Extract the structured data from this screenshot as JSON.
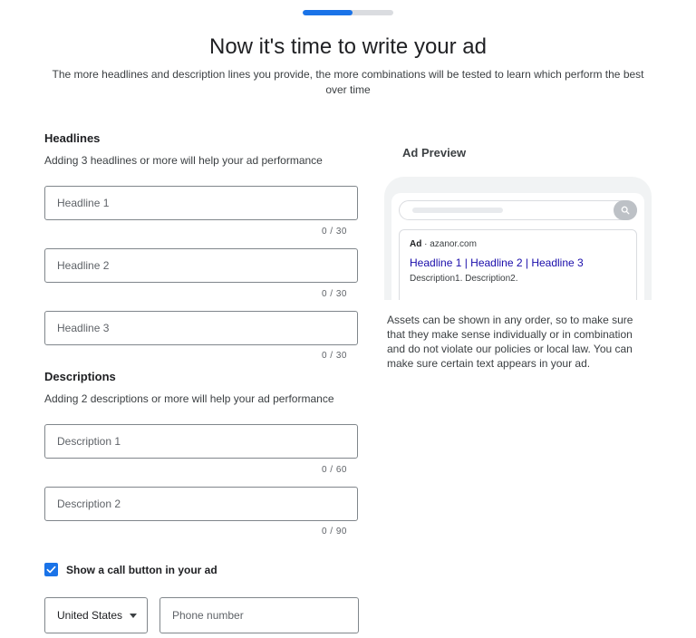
{
  "progress": {
    "value": 0.55,
    "color": "#1a73e8"
  },
  "title": "Now it's time to write your ad",
  "subtitle": "The more headlines and description lines you provide, the more combinations will be tested to learn which perform the best over time",
  "headlines": {
    "title": "Headlines",
    "hint": "Adding 3 headlines or more will help your ad performance",
    "fields": [
      {
        "placeholder": "Headline 1",
        "value": "",
        "counter": "0 / 30"
      },
      {
        "placeholder": "Headline 2",
        "value": "",
        "counter": "0 / 30"
      },
      {
        "placeholder": "Headline 3",
        "value": "",
        "counter": "0 / 30"
      }
    ]
  },
  "descriptions": {
    "title": "Descriptions",
    "hint": "Adding 2 descriptions or more will help your ad performance",
    "fields": [
      {
        "placeholder": "Description 1",
        "value": "",
        "counter": "0 / 60"
      },
      {
        "placeholder": "Description 2",
        "value": "",
        "counter": "0 / 90"
      }
    ]
  },
  "call_button": {
    "checked": true,
    "label": "Show a call button in your ad",
    "country": "United States",
    "phone_placeholder": "Phone number"
  },
  "preview": {
    "title": "Ad Preview",
    "ad_label": "Ad",
    "separator": " · ",
    "domain": "azanor.com",
    "headline": "Headline 1 | Headline 2 | Headline 3",
    "description": "Description1. Description2.",
    "note": "Assets can be shown in any order, so to make sure that they make sense individually or in combination and do not violate our policies or local law. You can make sure certain text appears in your ad."
  },
  "icons": {
    "search": "search-icon",
    "check": "check-icon",
    "dropdown": "dropdown-caret-icon"
  },
  "colors": {
    "accent": "#1a73e8",
    "ad_headline": "#1a0dab"
  }
}
